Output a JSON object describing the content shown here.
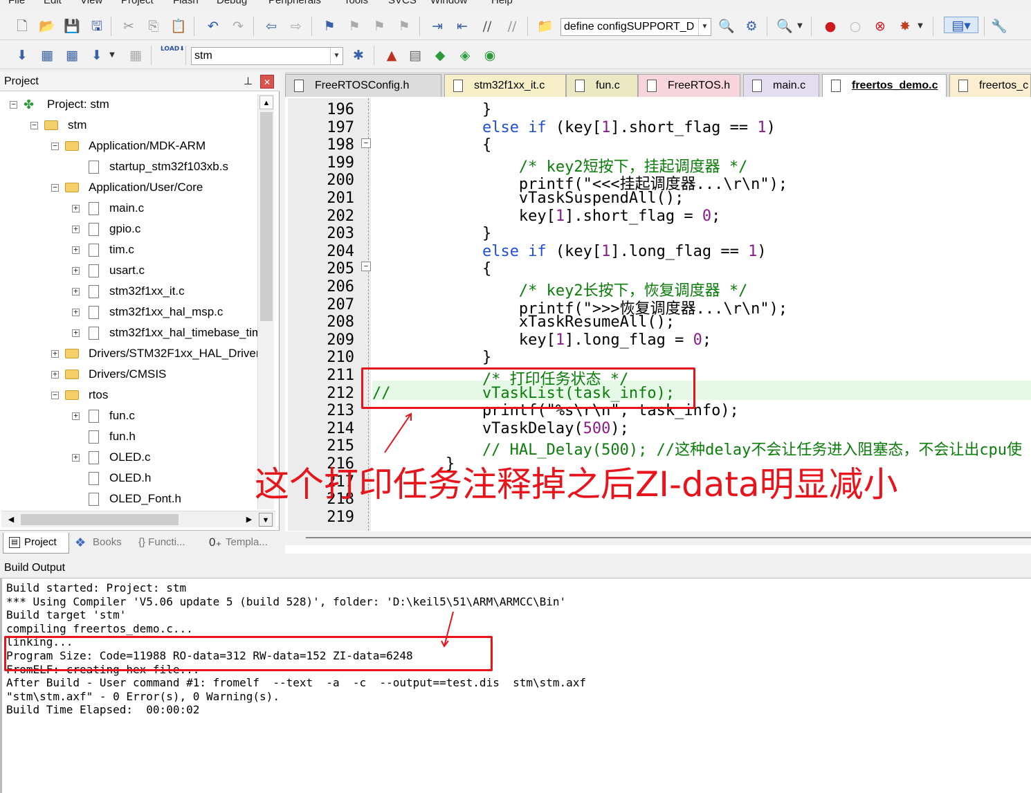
{
  "menu": [
    "File",
    "Edit",
    "View",
    "Project",
    "Flash",
    "Debug",
    "Peripherals",
    "Tools",
    "SVCS",
    "Window",
    "Help"
  ],
  "toolbar": {
    "find_combo": "define configSUPPORT_D",
    "target_combo": "stm",
    "load_label": "LOAD"
  },
  "project_panel": {
    "title": "Project",
    "pin": "❘",
    "close": "✕",
    "tree": [
      {
        "label": "Project: stm",
        "type": "root"
      },
      {
        "label": "stm",
        "type": "target"
      },
      {
        "label": "Application/MDK-ARM",
        "type": "folder"
      },
      {
        "label": "startup_stm32f103xb.s",
        "type": "file"
      },
      {
        "label": "Application/User/Core",
        "type": "folder"
      },
      {
        "label": "main.c",
        "type": "file"
      },
      {
        "label": "gpio.c",
        "type": "file"
      },
      {
        "label": "tim.c",
        "type": "file"
      },
      {
        "label": "usart.c",
        "type": "file"
      },
      {
        "label": "stm32f1xx_it.c",
        "type": "file"
      },
      {
        "label": "stm32f1xx_hal_msp.c",
        "type": "file"
      },
      {
        "label": "stm32f1xx_hal_timebase_tim",
        "type": "file"
      },
      {
        "label": "Drivers/STM32F1xx_HAL_Driver",
        "type": "folder"
      },
      {
        "label": "Drivers/CMSIS",
        "type": "folder"
      },
      {
        "label": "rtos",
        "type": "folder"
      },
      {
        "label": "fun.c",
        "type": "file"
      },
      {
        "label": "fun.h",
        "type": "file"
      },
      {
        "label": "OLED.c",
        "type": "file"
      },
      {
        "label": "OLED.h",
        "type": "file"
      },
      {
        "label": "OLED_Font.h",
        "type": "file"
      }
    ],
    "bottom_tabs": [
      "Project",
      "Books",
      "{} Functi...",
      "Templa..."
    ]
  },
  "editor": {
    "tabs": [
      {
        "label": "FreeRTOSConfig.h",
        "color": "#dcdcdc"
      },
      {
        "label": "stm32f1xx_it.c",
        "color": "#f7efc7"
      },
      {
        "label": "fun.c",
        "color": "#ebe9c4"
      },
      {
        "label": "FreeRTOS.h",
        "color": "#f6d5dc"
      },
      {
        "label": "main.c",
        "color": "#e4dcef"
      },
      {
        "label": "freertos_demo.c",
        "color": "#ffffff"
      },
      {
        "label": "freertos_c",
        "color": "#fbeed0"
      }
    ],
    "line_numbers": [
      "196",
      "197",
      "198",
      "199",
      "200",
      "201",
      "202",
      "203",
      "204",
      "205",
      "206",
      "207",
      "208",
      "209",
      "210",
      "211",
      "212",
      "213",
      "214",
      "215",
      "216",
      "217",
      "218",
      "219"
    ],
    "code": [
      "            }",
      "            else if (key[1].short_flag == 1)",
      "            {",
      "                /* key2短按下，挂起调度器 */",
      "                printf(\"<<<挂起调度器...\\r\\n\");",
      "                vTaskSuspendAll();",
      "                key[1].short_flag = 0;",
      "            }",
      "            else if (key[1].long_flag == 1)",
      "            {",
      "                /* key2长按下，恢复调度器 */",
      "                printf(\">>>恢复调度器...\\r\\n\");",
      "                xTaskResumeAll();",
      "                key[1].long_flag = 0;",
      "            }",
      "            /* 打印任务状态 */",
      "//          vTaskList(task_info);",
      "            printf(\"%s\\r\\n\", task_info);",
      "            vTaskDelay(500);",
      "            // HAL_Delay(500); //这种delay不会让任务进入阻塞态，不会让出cpu使",
      "        }",
      "",
      "",
      ""
    ]
  },
  "build_output": {
    "title": "Build Output",
    "lines": [
      "Build started: Project: stm",
      "*** Using Compiler 'V5.06 update 5 (build 528)', folder: 'D:\\keil5\\51\\ARM\\ARMCC\\Bin'",
      "Build target 'stm'",
      "compiling freertos_demo.c...",
      "linking...",
      "Program Size: Code=11988 RO-data=312 RW-data=152 ZI-data=6248",
      "FromELF: creating hex file...",
      "After Build - User command #1: fromelf  --text  -a  -c  --output==test.dis  stm\\stm.axf",
      "\"stm\\stm.axf\" - 0 Error(s), 0 Warning(s).",
      "Build Time Elapsed:  00:00:02"
    ]
  },
  "annotation": {
    "text": "这个打印任务注释掉之后ZI-data明显减小",
    "color": "#e8141c"
  }
}
